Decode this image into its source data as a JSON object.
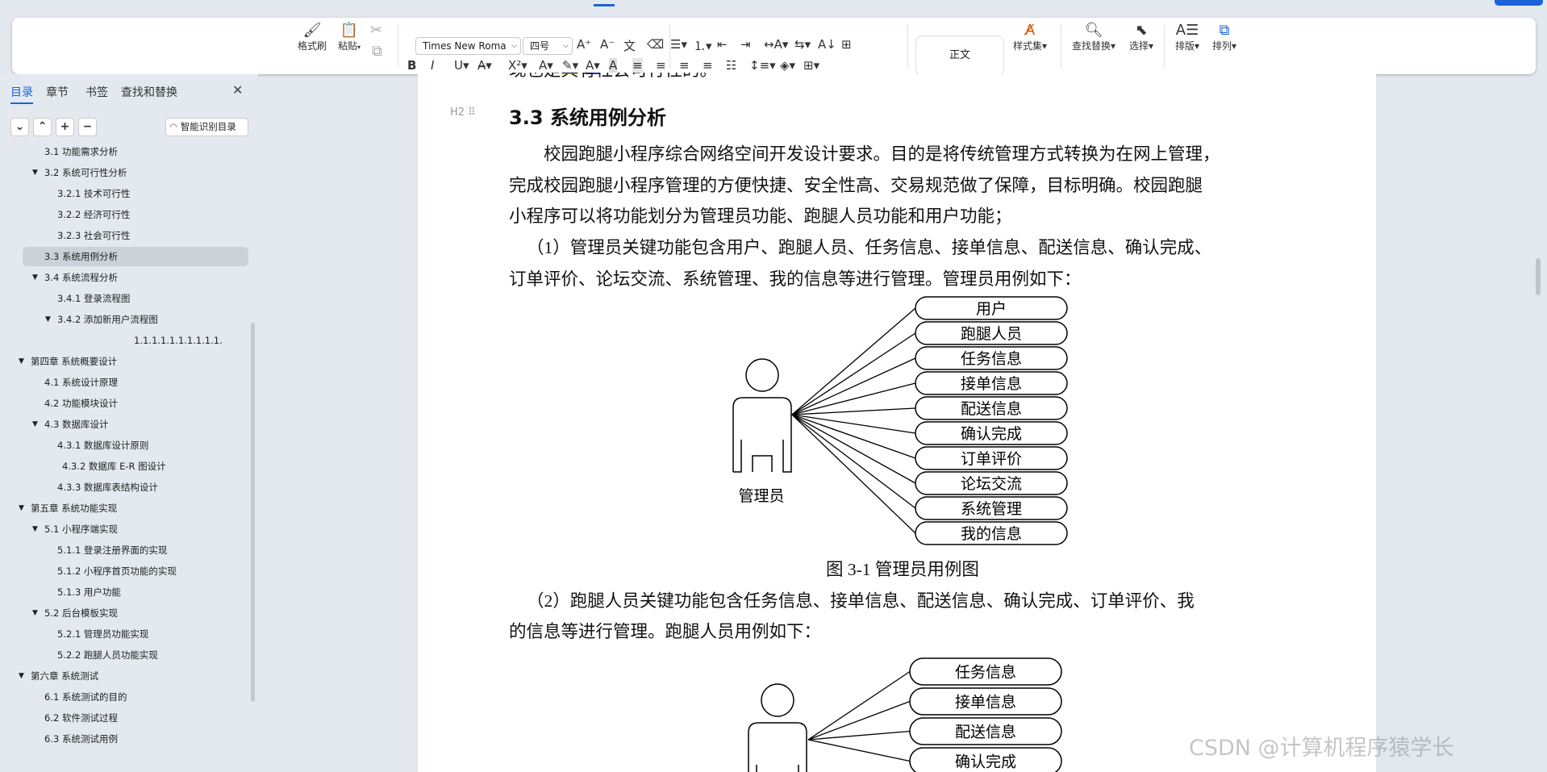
{
  "colors": {
    "accent": "#1a63d8",
    "highlight": "#f5e100",
    "fontcolor": "#1030d0"
  },
  "toolbar": {
    "format_painter": "格式刷",
    "paste": "粘贴",
    "font_name": "Times New Roma",
    "font_size": "四号",
    "style_normal": "正文",
    "style_set": "样式集",
    "find_replace": "查找替换",
    "select": "选择",
    "layout": "排版",
    "arrange": "排列",
    "row1_icons": [
      "increase-font-icon",
      "decrease-font-icon",
      "phonetic-icon",
      "clear-format-icon",
      "bullet-list-icon",
      "numbered-list-icon",
      "outdent-icon",
      "indent-icon",
      "char-spacing-icon",
      "text-direction-icon",
      "sort-icon",
      "table-icon"
    ],
    "row2_icons": [
      "bold-icon",
      "italic-icon",
      "underline-icon",
      "strikethrough-icon",
      "superscript-icon",
      "text-effect-icon",
      "highlight-icon",
      "font-color-icon",
      "char-shading-icon",
      "align-left-icon",
      "align-center-icon",
      "align-right-icon",
      "justify-icon",
      "distributed-icon",
      "line-spacing-icon",
      "shading-icon",
      "border-icon"
    ]
  },
  "sidebar": {
    "tabs": [
      "目录",
      "章节",
      "书签",
      "查找和替换"
    ],
    "smart_toc": "智能识别目录",
    "items": [
      {
        "text": "3.1 功能需求分析",
        "level": 2,
        "arrow": false
      },
      {
        "text": "3.2 系统可行性分析",
        "level": 2,
        "arrow": true
      },
      {
        "text": "3.2.1 技术可行性",
        "level": 3,
        "arrow": false
      },
      {
        "text": "3.2.2  经济可行性",
        "level": 3,
        "arrow": false
      },
      {
        "text": "3.2.3 社会可行性",
        "level": 3,
        "arrow": false
      },
      {
        "text": "3.3  系统用例分析",
        "level": 2,
        "arrow": false,
        "selected": true
      },
      {
        "text": "3.4 系统流程分析",
        "level": 2,
        "arrow": true
      },
      {
        "text": "3.4.1  登录流程图",
        "level": 3,
        "arrow": false
      },
      {
        "text": "3.4.2  添加新用户流程图",
        "level": 3,
        "arrow": true
      },
      {
        "text": "1.1.1.1.1.1.1.1.1.1.",
        "level": 5,
        "arrow": false
      },
      {
        "text": "第四章  系统概要设计",
        "level": 1,
        "arrow": true
      },
      {
        "text": "4.1 系统设计原理",
        "level": 2,
        "arrow": false
      },
      {
        "text": "4.2 功能模块设计",
        "level": 2,
        "arrow": false
      },
      {
        "text": "4.3  数据库设计",
        "level": 2,
        "arrow": true
      },
      {
        "text": "4.3.1 数据库设计原则",
        "level": 3,
        "arrow": false
      },
      {
        "text": "4.3.2 数据库 E-R 图设计",
        "level": 4,
        "arrow": false
      },
      {
        "text": "4.3.3 数据库表结构设计",
        "level": 3,
        "arrow": false
      },
      {
        "text": "第五章  系统功能实现",
        "level": 1,
        "arrow": true
      },
      {
        "text": "5.1 小程序端实现",
        "level": 2,
        "arrow": true
      },
      {
        "text": "5.1.1 登录注册界面的实现",
        "level": 3,
        "arrow": false
      },
      {
        "text": "5.1.2 小程序首页功能的实现",
        "level": 3,
        "arrow": false
      },
      {
        "text": "5.1.3 用户功能",
        "level": 3,
        "arrow": false
      },
      {
        "text": "5.2 后台模板实现",
        "level": 2,
        "arrow": true
      },
      {
        "text": "5.2.1 管理员功能实现",
        "level": 3,
        "arrow": false
      },
      {
        "text": "5.2.2 跑腿人员功能实现",
        "level": 3,
        "arrow": false
      },
      {
        "text": "第六章  系统测试",
        "level": 1,
        "arrow": true
      },
      {
        "text": "6.1 系统测试的目的",
        "level": 2,
        "arrow": false
      },
      {
        "text": "6.2 软件测试过程",
        "level": 2,
        "arrow": false
      },
      {
        "text": "6.3 系统测试用例",
        "level": 2,
        "arrow": false
      }
    ]
  },
  "document": {
    "cut_line": "现也是具有社会可行性的。",
    "heading_marker": "H2",
    "heading": "3.3  系统用例分析",
    "para1": [
      "校园跑腿小程序综合网络空间开发设计要求。目的是将传统管理方式转换为在网上管理，",
      "完成校园跑腿小程序管理的方便快捷、安全性高、交易规范做了保障，目标明确。校园跑腿",
      "小程序可以将功能划分为管理员功能、跑腿人员功能和用户功能；"
    ],
    "para2": [
      "（1）管理员关键功能包含用户、跑腿人员、任务信息、接单信息、配送信息、确认完成、",
      "订单评价、论坛交流、系统管理、我的信息等进行管理。管理员用例如下："
    ],
    "diagram1": {
      "actor": "管理员",
      "use_cases": [
        "用户",
        "跑腿人员",
        "任务信息",
        "接单信息",
        "配送信息",
        "确认完成",
        "订单评价",
        "论坛交流",
        "系统管理",
        "我的信息"
      ]
    },
    "caption1": "图 3-1  管理员用例图",
    "para3": [
      "（2）跑腿人员关键功能包含任务信息、接单信息、配送信息、确认完成、订单评价、我",
      "的信息等进行管理。跑腿人员用例如下："
    ],
    "diagram2": {
      "use_cases": [
        "任务信息",
        "接单信息",
        "配送信息",
        "确认完成"
      ]
    }
  },
  "watermark": "CSDN @计算机程序猿学长"
}
